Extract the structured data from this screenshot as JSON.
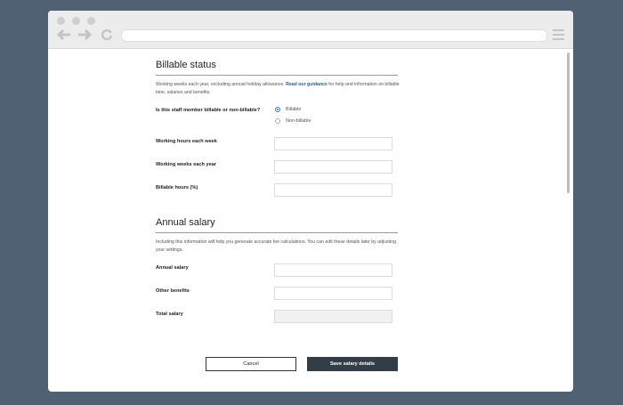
{
  "billable": {
    "title": "Billable status",
    "intro_before": "Working weeks each year, excluding annual holiday allowance.",
    "intro_link": "Read our guidance",
    "intro_after": "for help and information on billable time, salaries and benefits.",
    "question": "Is this staff member billable or non-billable?",
    "options": [
      "Billable",
      "Non-billable"
    ],
    "selected": "Billable",
    "fields": [
      {
        "label": "Working hours each week",
        "value": ""
      },
      {
        "label": "Working weeks each year",
        "value": ""
      },
      {
        "label": "Billable hours (%)",
        "value": ""
      }
    ]
  },
  "salary": {
    "title": "Annual salary",
    "intro": "Including this information will help you generate accurate fee calculations. You can edit these details later by adjusting your settings.",
    "fields": [
      {
        "label": "Annual salary",
        "value": ""
      },
      {
        "label": "Other benefits",
        "value": ""
      },
      {
        "label": "Total salary",
        "value": ""
      }
    ]
  },
  "actions": {
    "cancel": "Cancel",
    "save": "Save salary details"
  }
}
